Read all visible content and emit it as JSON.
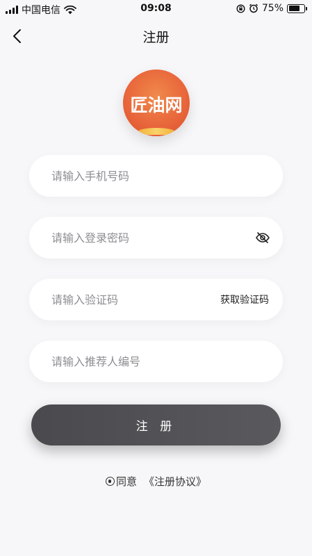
{
  "status_bar": {
    "carrier": "中国电信",
    "time": "09:08",
    "battery": "75%",
    "battery_level": 0.75
  },
  "header": {
    "title": "注册"
  },
  "logo": {
    "text": "匠油网"
  },
  "form": {
    "phone_placeholder": "请输入手机号码",
    "password_placeholder": "请输入登录密码",
    "code_placeholder": "请输入验证码",
    "get_code_label": "获取验证码",
    "referrer_placeholder": "请输入推荐人编号"
  },
  "register_label": "注 册",
  "agreement": {
    "agree_label": "同意",
    "link_label": "《注册协议》"
  }
}
